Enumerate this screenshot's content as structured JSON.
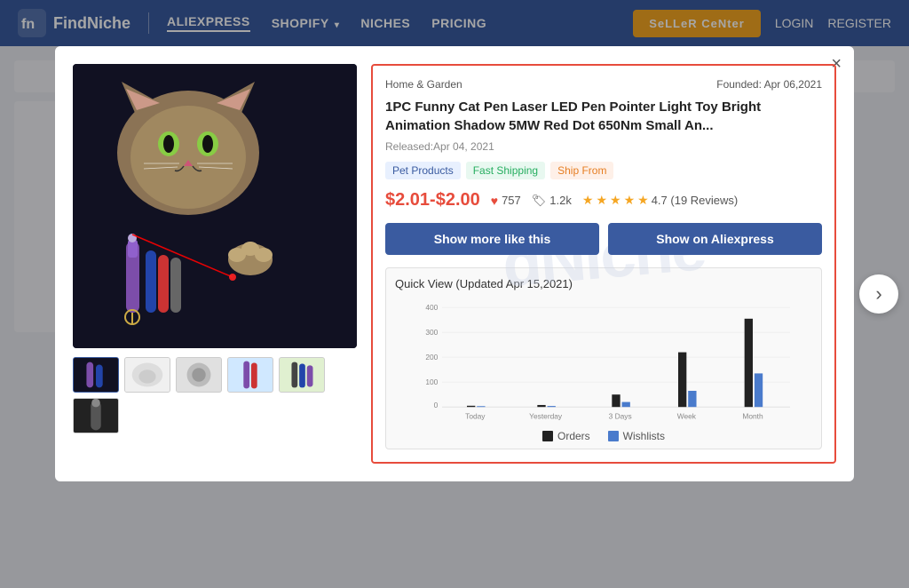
{
  "navbar": {
    "logo_text": "FindNiche",
    "nav_links": [
      {
        "label": "ALIEXPRESS",
        "active": true
      },
      {
        "label": "SHOPIFY",
        "has_dropdown": true
      },
      {
        "label": "NICHES"
      },
      {
        "label": "PRICING"
      }
    ],
    "seller_btn": "SeLLeR CeNter",
    "login": "LOGIN",
    "register": "REGISTER"
  },
  "modal": {
    "close": "×",
    "category": "Home & Garden",
    "founded": "Founded: Apr 06,2021",
    "product_title": "1PC Funny Cat Pen Laser LED Pen Pointer Light Toy Bright Animation Shadow 5MW Red Dot 650Nm Small An...",
    "released": "Released:Apr 04, 2021",
    "tags": [
      {
        "label": "Pet Products",
        "type": "pet"
      },
      {
        "label": "Fast Shipping",
        "type": "shipping"
      },
      {
        "label": "Ship From",
        "type": "ship"
      }
    ],
    "price": "$2.01-$2.00",
    "hearts": "757",
    "tags_count": "1.2k",
    "rating": "4.7",
    "reviews": "19 Reviews",
    "stars": [
      1,
      1,
      1,
      1,
      0.5
    ],
    "btn_show_more": "Show more like this",
    "btn_aliexpress": "Show on Aliexpress",
    "quick_view_title": "Quick View",
    "quick_view_updated": "(Updated Apr 15,2021)",
    "watermark": "dNiche",
    "chart": {
      "labels": [
        "Today",
        "Yesterday",
        "3 Days",
        "Week",
        "Month"
      ],
      "orders": [
        5,
        8,
        50,
        220,
        355
      ],
      "wishlists": [
        3,
        4,
        20,
        65,
        135
      ]
    },
    "legend": {
      "orders": "Orders",
      "wishlists": "Wishlists"
    },
    "thumbnails": 6
  }
}
